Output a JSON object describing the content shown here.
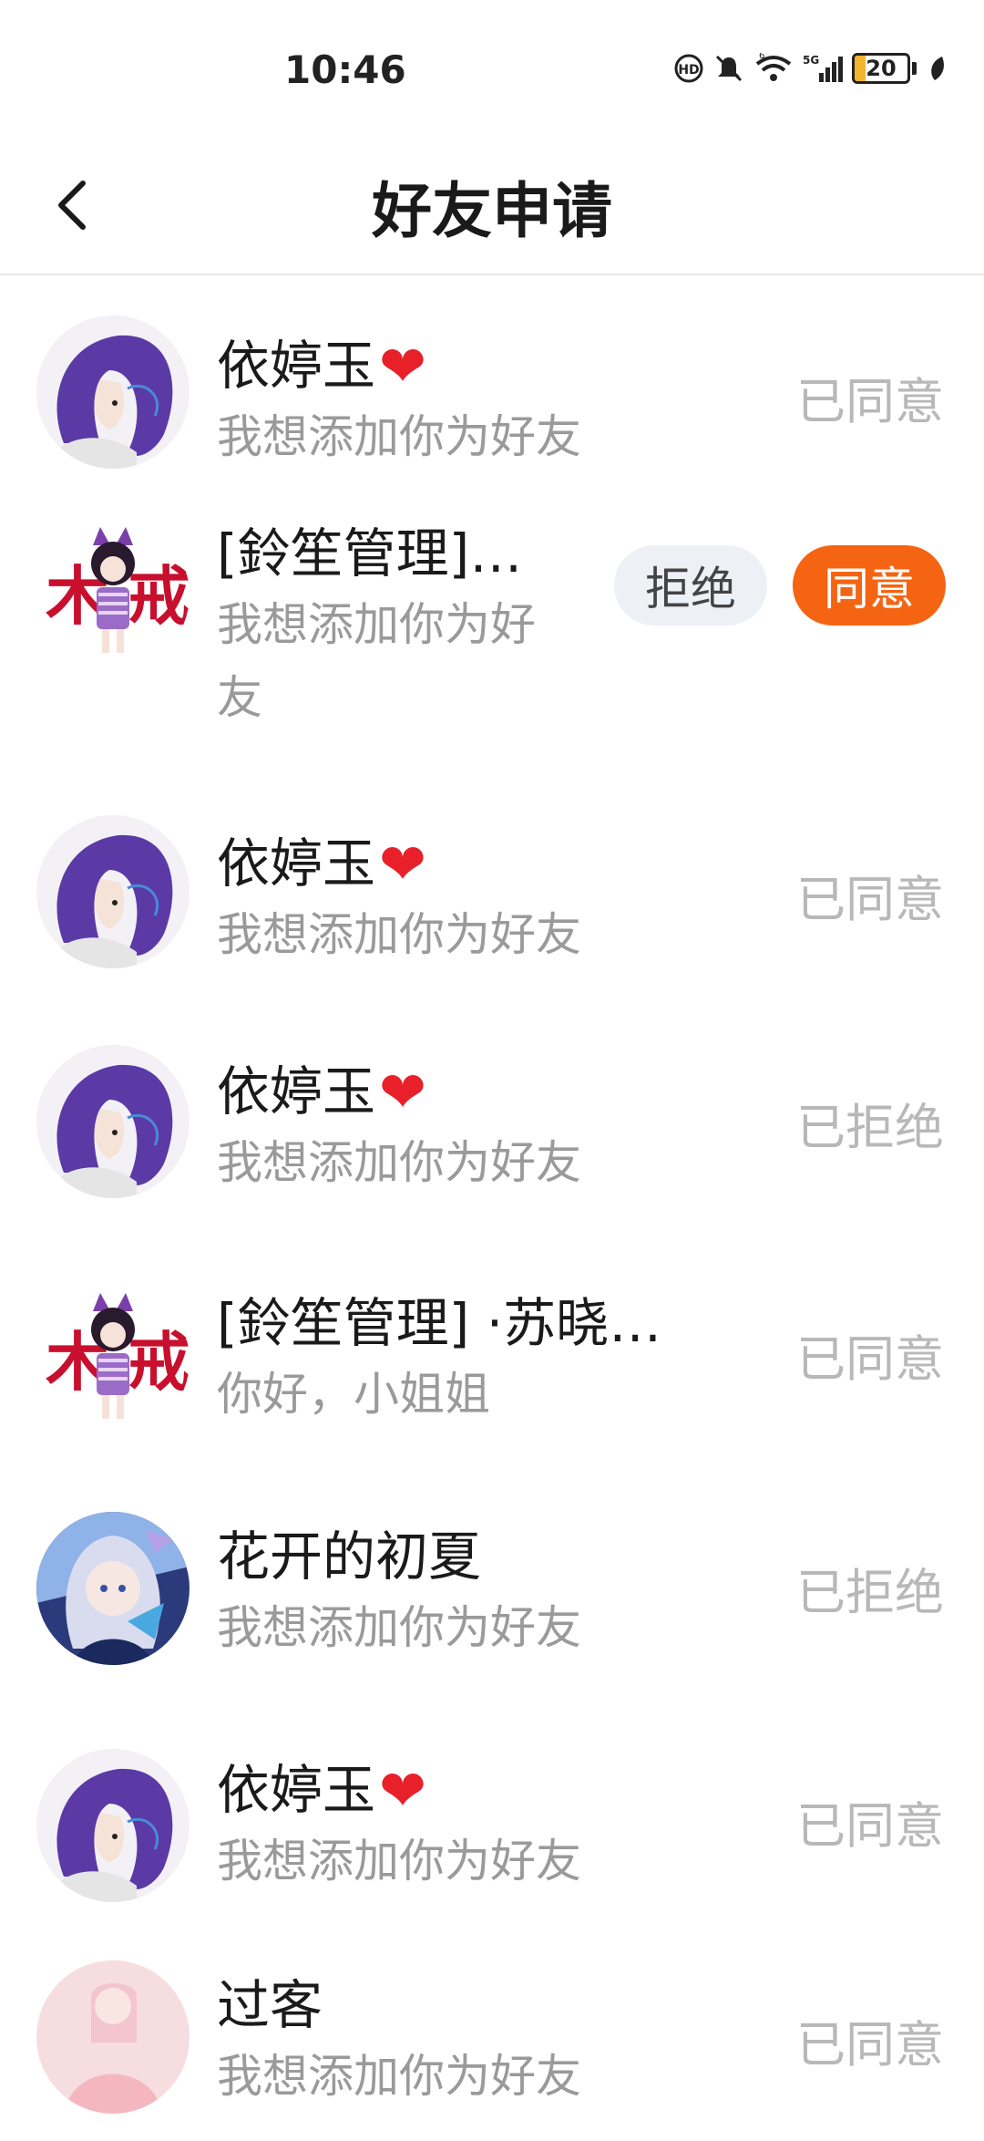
{
  "status_bar": {
    "time": "10:46",
    "battery": "20",
    "battery_level": 0.2,
    "signal": "5G",
    "wifi_badge": "6",
    "icons": [
      "hd-icon",
      "mute-icon",
      "wifi-icon",
      "signal-icon",
      "battery-icon",
      "leaf-icon"
    ]
  },
  "header": {
    "title": "好友申请",
    "back_icon": "chevron-left-icon"
  },
  "colors": {
    "accent": "#f46412",
    "status_text": "#b8b8b8",
    "message_text": "#9a9a9a",
    "reject_bg": "#edf0f5"
  },
  "requests": [
    {
      "name": "依婷玉",
      "heart": "❤",
      "message": "我想添加你为好友",
      "status": "已同意",
      "avatar": "purple-hair-avatar"
    },
    {
      "name": "[鈴笙管理]…",
      "message": "我想添加你为好",
      "message_line2": "友",
      "reject_label": "拒绝",
      "accept_label": "同意",
      "avatar": "cat-ear-avatar"
    },
    {
      "name": "依婷玉",
      "heart": "❤",
      "message": "我想添加你为好友",
      "status": "已同意",
      "avatar": "purple-hair-avatar"
    },
    {
      "name": "依婷玉",
      "heart": "❤",
      "message": "我想添加你为好友",
      "status": "已拒绝",
      "avatar": "purple-hair-avatar"
    },
    {
      "name": "[鈴笙管理] ·苏晓…",
      "message": "你好，小姐姐",
      "status": "已同意",
      "avatar": "cat-ear-avatar"
    },
    {
      "name": "花开的初夏",
      "message": "我想添加你为好友",
      "status": "已拒绝",
      "avatar": "silver-hair-avatar"
    },
    {
      "name": "依婷玉",
      "heart": "❤",
      "message": "我想添加你为好友",
      "status": "已同意",
      "avatar": "purple-hair-avatar"
    },
    {
      "name": "过客",
      "message": "我想添加你为好友",
      "status": "已同意",
      "avatar": "pink-photo-avatar"
    }
  ]
}
